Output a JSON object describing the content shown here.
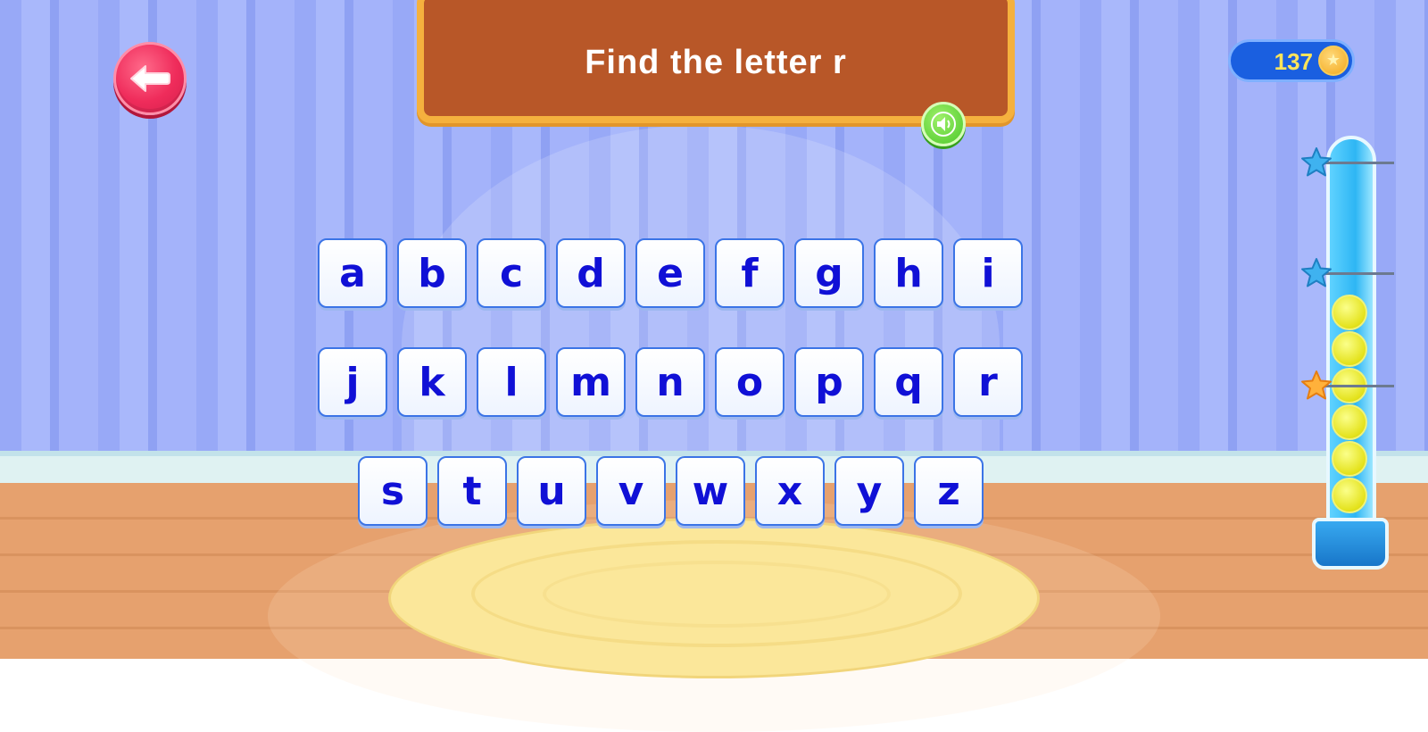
{
  "prompt": {
    "text": "Find the letter r"
  },
  "coins": {
    "value": "137"
  },
  "progress": {
    "balls": 6,
    "stars": 3,
    "stars_earned": 1
  },
  "colors": {
    "back_button": "#ef2c5b",
    "board": "#b85728",
    "board_border": "#f5b13e",
    "key_text": "#1010d6",
    "key_border": "#3b74e6",
    "coin_pill": "#1a5fe0",
    "sound_button": "#4cc82a"
  },
  "icons": {
    "back": "arrow-left-icon",
    "sound": "speaker-icon",
    "coin": "coin-star-icon",
    "star": "star-icon",
    "ball": "tennis-ball-icon"
  },
  "letter_rows": [
    [
      "a",
      "b",
      "c",
      "d",
      "e",
      "f",
      "g",
      "h",
      "i"
    ],
    [
      "j",
      "k",
      "l",
      "m",
      "n",
      "o",
      "p",
      "q",
      "r"
    ],
    [
      "s",
      "t",
      "u",
      "v",
      "w",
      "x",
      "y",
      "z"
    ]
  ]
}
